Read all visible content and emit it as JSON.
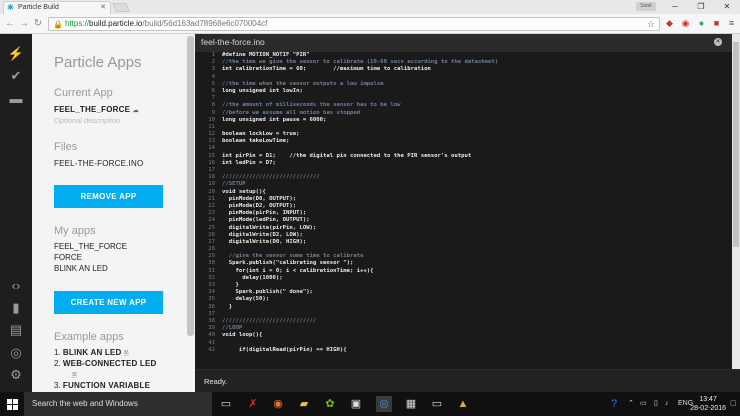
{
  "browser": {
    "tab_title": "Particle Build",
    "tab_favicon": "particle-star-icon",
    "profile_badge": "Sonit",
    "url_scheme": "https://",
    "url_host": "build.particle.io",
    "url_path": "/build/56d163ad78968e6c070004cf"
  },
  "panel": {
    "title": "Particle Apps",
    "current_app_label": "Current App",
    "current_app_name": "FEEL_THE_FORCE",
    "current_app_desc": "Optional description",
    "files_label": "Files",
    "file_name": "FEEL-THE-FORCE.INO",
    "remove_button": "REMOVE APP",
    "my_apps_label": "My apps",
    "my_apps": [
      "FEEL_THE_FORCE",
      "FORCE",
      "BLINK AN LED"
    ],
    "create_button": "CREATE NEW APP",
    "example_label": "Example apps",
    "examples": [
      {
        "num": "1.",
        "name": "BLINK AN LED"
      },
      {
        "num": "2.",
        "name": "WEB-CONNECTED LED"
      },
      {
        "num": "3.",
        "name": "FUNCTION VARIABLE"
      }
    ]
  },
  "editor": {
    "tab_name": "feel-the-force.ino",
    "status": "Ready.",
    "lines": [
      "#define MOTION_NOTIF \"PIR\"",
      "//the time we give the sensor to calibrate (10-60 secs according to the datasheet)",
      "int calibrationTime = 60;        //maximum time to calibration",
      "",
      "//the time when the sensor outputs a low impulse",
      "long unsigned int lowIn;",
      "",
      "//the amount of milliseconds the sensor has to be low",
      "//before we assume all motion has stopped",
      "long unsigned int pause = 6000;",
      "",
      "boolean lockLow = true;",
      "boolean takeLowTime;",
      "",
      "int pirPin = D1;    //the digital pin connected to the PIR sensor's output",
      "int ledPin = D7;",
      "",
      "/////////////////////////////",
      "//SETUP",
      "void setup(){",
      "  pinMode(D0, OUTPUT);",
      "  pinMode(D2, OUTPUT);",
      "  pinMode(pirPin, INPUT);",
      "  pinMode(ledPin, OUTPUT);",
      "  digitalWrite(pirPin, LOW);",
      "  digitalWrite(D2, LOW);",
      "  digitalWrite(D0, HIGH);",
      "",
      "  //give the sensor some time to calibrate",
      "  Spark.publish(\"calibrating sensor \");",
      "    for(int i = 0; i < calibrationTime; i++){",
      "      delay(1000);",
      "    }",
      "    Spark.publish(\" done\");",
      "    delay(50);",
      "  }",
      "",
      "////////////////////////////",
      "//LOOP",
      "void loop(){",
      "",
      "     if(digitalRead(pirPin) == HIGH){"
    ]
  },
  "taskbar": {
    "search_placeholder": "Search the web and Windows",
    "language": "ENG",
    "time": "13:47",
    "date": "28-02-2016"
  }
}
